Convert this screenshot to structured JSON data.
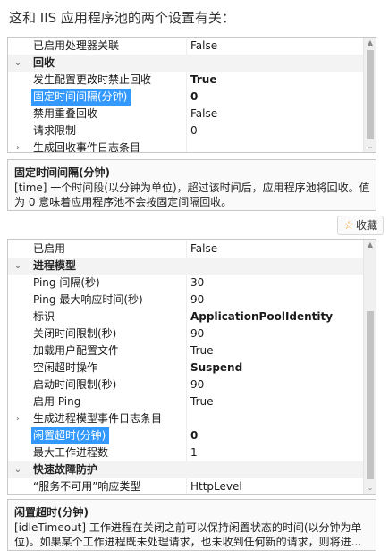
{
  "intro": "这和 IIS 应用程序池的两个设置有关：",
  "panel1": {
    "rows": [
      {
        "type": "prop",
        "name": "已启用处理器关联",
        "value": "False"
      },
      {
        "type": "category",
        "expander": "⌄",
        "name": "回收",
        "value": ""
      },
      {
        "type": "prop",
        "name": "发生配置更改时禁止回收",
        "value": "True",
        "bold": true
      },
      {
        "type": "prop",
        "name": "固定时间间隔(分钟)",
        "value": "0",
        "selected": true
      },
      {
        "type": "prop",
        "name": "禁用重叠回收",
        "value": "False"
      },
      {
        "type": "prop",
        "name": "请求限制",
        "value": "0"
      },
      {
        "type": "prop",
        "expander": "›",
        "name": "生成回收事件日志条目",
        "value": ""
      }
    ]
  },
  "desc1": {
    "title": "固定时间间隔(分钟)",
    "text": "[time] 一个时间段(以分钟为单位)，超过该时间后，应用程序池将回收。值为 0 意味着应用程序池不会按固定间隔回收。"
  },
  "favorite": {
    "label": "收藏",
    "icon": "star-icon"
  },
  "panel2": {
    "rows": [
      {
        "type": "prop",
        "name": "已启用",
        "value": "False"
      },
      {
        "type": "category",
        "expander": "⌄",
        "name": "进程模型",
        "value": ""
      },
      {
        "type": "prop",
        "name": "Ping 间隔(秒)",
        "value": "30"
      },
      {
        "type": "prop",
        "name": "Ping 最大响应时间(秒)",
        "value": "90"
      },
      {
        "type": "prop",
        "name": "标识",
        "value": "ApplicationPoolIdentity",
        "bold": true
      },
      {
        "type": "prop",
        "name": "关闭时间限制(秒)",
        "value": "90"
      },
      {
        "type": "prop",
        "name": "加载用户配置文件",
        "value": "True"
      },
      {
        "type": "prop",
        "name": "空闲超时操作",
        "value": "Suspend",
        "bold": true
      },
      {
        "type": "prop",
        "name": "启动时间限制(秒)",
        "value": "90"
      },
      {
        "type": "prop",
        "name": "启用 Ping",
        "value": "True"
      },
      {
        "type": "prop",
        "expander": "›",
        "name": "生成进程模型事件日志条目",
        "value": ""
      },
      {
        "type": "prop",
        "name": "闲置超时(分钟)",
        "value": "0",
        "selected": true
      },
      {
        "type": "prop",
        "name": "最大工作进程数",
        "value": "1"
      },
      {
        "type": "category",
        "expander": "⌄",
        "name": "快速故障防护",
        "value": ""
      },
      {
        "type": "prop",
        "name": "“服务不可用”响应类型",
        "value": "HttpLevel"
      }
    ]
  },
  "desc2": {
    "title": "闲置超时(分钟)",
    "text": "[idleTimeout] 工作进程在关闭之前可以保持闲置状态的时间(以分钟为单位)。如果某个工作进程既未处理请求，也未收到任何新的请求，则将进..."
  }
}
